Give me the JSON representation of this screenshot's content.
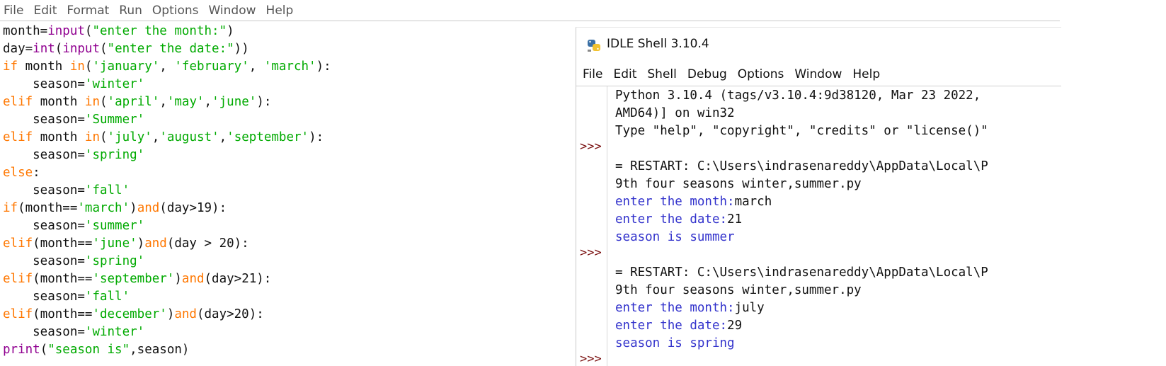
{
  "editor": {
    "menu": [
      "File",
      "Edit",
      "Format",
      "Run",
      "Options",
      "Window",
      "Help"
    ],
    "code_lines": [
      [
        {
          "t": "month=",
          "c": "p"
        },
        {
          "t": "input",
          "c": "bi"
        },
        {
          "t": "(",
          "c": "p"
        },
        {
          "t": "\"enter the month:\"",
          "c": "str"
        },
        {
          "t": ")",
          "c": "p"
        }
      ],
      [
        {
          "t": "day=",
          "c": "p"
        },
        {
          "t": "int",
          "c": "bi"
        },
        {
          "t": "(",
          "c": "p"
        },
        {
          "t": "input",
          "c": "bi"
        },
        {
          "t": "(",
          "c": "p"
        },
        {
          "t": "\"enter the date:\"",
          "c": "str"
        },
        {
          "t": "))",
          "c": "p"
        }
      ],
      [
        {
          "t": "if",
          "c": "kw"
        },
        {
          "t": " month ",
          "c": "p"
        },
        {
          "t": "in",
          "c": "kw"
        },
        {
          "t": "(",
          "c": "p"
        },
        {
          "t": "'january'",
          "c": "str"
        },
        {
          "t": ", ",
          "c": "p"
        },
        {
          "t": "'february'",
          "c": "str"
        },
        {
          "t": ", ",
          "c": "p"
        },
        {
          "t": "'march'",
          "c": "str"
        },
        {
          "t": "):",
          "c": "p"
        }
      ],
      [
        {
          "t": "    season=",
          "c": "p"
        },
        {
          "t": "'winter'",
          "c": "str"
        }
      ],
      [
        {
          "t": "elif",
          "c": "kw"
        },
        {
          "t": " month ",
          "c": "p"
        },
        {
          "t": "in",
          "c": "kw"
        },
        {
          "t": "(",
          "c": "p"
        },
        {
          "t": "'april'",
          "c": "str"
        },
        {
          "t": ",",
          "c": "p"
        },
        {
          "t": "'may'",
          "c": "str"
        },
        {
          "t": ",",
          "c": "p"
        },
        {
          "t": "'june'",
          "c": "str"
        },
        {
          "t": "):",
          "c": "p"
        }
      ],
      [
        {
          "t": "    season=",
          "c": "p"
        },
        {
          "t": "'Summer'",
          "c": "str"
        }
      ],
      [
        {
          "t": "elif",
          "c": "kw"
        },
        {
          "t": " month ",
          "c": "p"
        },
        {
          "t": "in",
          "c": "kw"
        },
        {
          "t": "(",
          "c": "p"
        },
        {
          "t": "'july'",
          "c": "str"
        },
        {
          "t": ",",
          "c": "p"
        },
        {
          "t": "'august'",
          "c": "str"
        },
        {
          "t": ",",
          "c": "p"
        },
        {
          "t": "'september'",
          "c": "str"
        },
        {
          "t": "):",
          "c": "p"
        }
      ],
      [
        {
          "t": "    season=",
          "c": "p"
        },
        {
          "t": "'spring'",
          "c": "str"
        }
      ],
      [
        {
          "t": "else",
          "c": "kw"
        },
        {
          "t": ":",
          "c": "p"
        }
      ],
      [
        {
          "t": "    season=",
          "c": "p"
        },
        {
          "t": "'fall'",
          "c": "str"
        }
      ],
      [
        {
          "t": "if",
          "c": "kw"
        },
        {
          "t": "(month==",
          "c": "p"
        },
        {
          "t": "'march'",
          "c": "str"
        },
        {
          "t": ")",
          "c": "p"
        },
        {
          "t": "and",
          "c": "kw"
        },
        {
          "t": "(day>19):",
          "c": "p"
        }
      ],
      [
        {
          "t": "    season=",
          "c": "p"
        },
        {
          "t": "'summer'",
          "c": "str"
        }
      ],
      [
        {
          "t": "elif",
          "c": "kw"
        },
        {
          "t": "(month==",
          "c": "p"
        },
        {
          "t": "'june'",
          "c": "str"
        },
        {
          "t": ")",
          "c": "p"
        },
        {
          "t": "and",
          "c": "kw"
        },
        {
          "t": "(day > 20):",
          "c": "p"
        }
      ],
      [
        {
          "t": "    season=",
          "c": "p"
        },
        {
          "t": "'spring'",
          "c": "str"
        }
      ],
      [
        {
          "t": "elif",
          "c": "kw"
        },
        {
          "t": "(month==",
          "c": "p"
        },
        {
          "t": "'september'",
          "c": "str"
        },
        {
          "t": ")",
          "c": "p"
        },
        {
          "t": "and",
          "c": "kw"
        },
        {
          "t": "(day>21):",
          "c": "p"
        }
      ],
      [
        {
          "t": "    season=",
          "c": "p"
        },
        {
          "t": "'fall'",
          "c": "str"
        }
      ],
      [
        {
          "t": "elif",
          "c": "kw"
        },
        {
          "t": "(month==",
          "c": "p"
        },
        {
          "t": "'december'",
          "c": "str"
        },
        {
          "t": ")",
          "c": "p"
        },
        {
          "t": "and",
          "c": "kw"
        },
        {
          "t": "(day>20):",
          "c": "p"
        }
      ],
      [
        {
          "t": "    season=",
          "c": "p"
        },
        {
          "t": "'winter'",
          "c": "str"
        }
      ],
      [
        {
          "t": "print",
          "c": "bi"
        },
        {
          "t": "(",
          "c": "p"
        },
        {
          "t": "\"season is\"",
          "c": "str"
        },
        {
          "t": ",season)",
          "c": "p"
        }
      ]
    ]
  },
  "shell": {
    "title": "IDLE Shell 3.10.4",
    "icon": "python-icon",
    "menu": [
      "File",
      "Edit",
      "Shell",
      "Debug",
      "Options",
      "Window",
      "Help"
    ],
    "prompt": ">>>",
    "prompt_rows": [
      3,
      9,
      15
    ],
    "lines": [
      {
        "t": "Python 3.10.4 (tags/v3.10.4:9d38120, Mar 23 2022,",
        "c": "out"
      },
      {
        "t": "AMD64)] on win32",
        "c": "out"
      },
      {
        "t": "Type \"help\", \"copyright\", \"credits\" or \"license()\"",
        "c": "out"
      },
      {
        "t": "",
        "c": "out"
      },
      {
        "t": "= RESTART: C:\\Users\\indrasenareddy\\AppData\\Local\\P",
        "c": "out"
      },
      {
        "t": "9th four seasons winter,summer.py",
        "c": "out"
      },
      {
        "t": "enter the month:",
        "c": "stdout",
        "input": "march"
      },
      {
        "t": "enter the date:",
        "c": "stdout",
        "input": "21"
      },
      {
        "t": "season is summer",
        "c": "stdout"
      },
      {
        "t": "",
        "c": "out"
      },
      {
        "t": "= RESTART: C:\\Users\\indrasenareddy\\AppData\\Local\\P",
        "c": "out"
      },
      {
        "t": "9th four seasons winter,summer.py",
        "c": "out"
      },
      {
        "t": "enter the month:",
        "c": "stdout",
        "input": "july"
      },
      {
        "t": "enter the date:",
        "c": "stdout",
        "input": "29"
      },
      {
        "t": "season is spring",
        "c": "stdout"
      },
      {
        "t": "",
        "c": "out"
      }
    ]
  },
  "colors": {
    "keyword": "#ff7700",
    "builtin": "#900090",
    "string": "#00aa00",
    "stdout": "#3333cc",
    "prompt": "#7a1010"
  }
}
